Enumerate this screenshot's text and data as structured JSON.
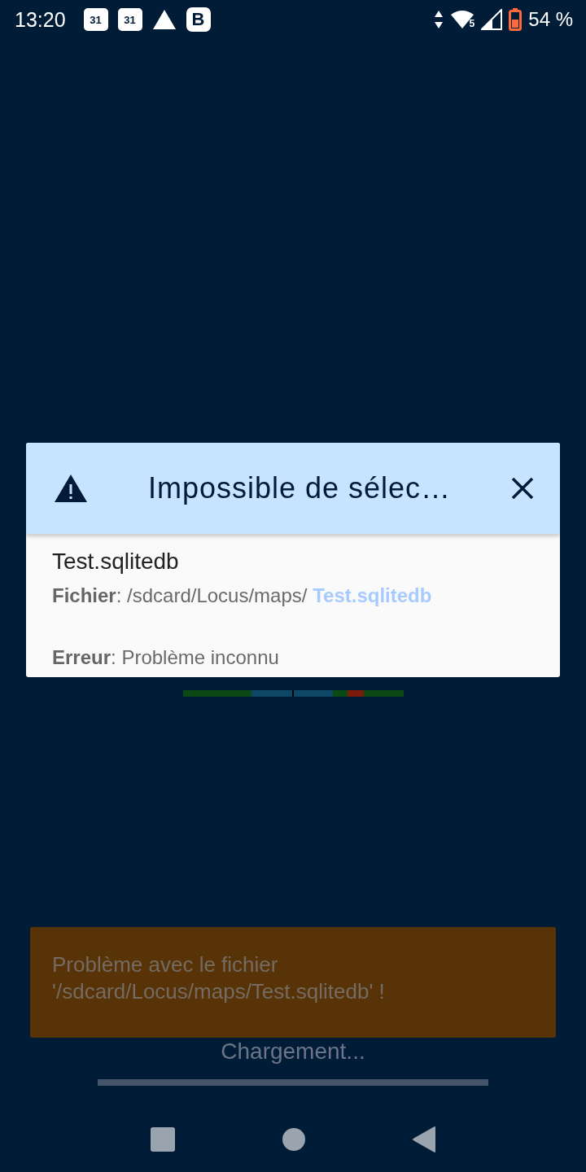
{
  "status_bar": {
    "time": "13:20",
    "notification_icons": [
      {
        "kind": "calendar",
        "text": "31"
      },
      {
        "kind": "calendar",
        "text": "31"
      },
      {
        "kind": "triangle"
      },
      {
        "kind": "badge",
        "text": "B"
      }
    ],
    "wifi_label": "5",
    "battery": "54 %"
  },
  "dialog": {
    "title": "Impossible de sélec…",
    "file_name": "Test.sqlitedb",
    "details": [
      {
        "text": "**Fichier**: /sdcard/Locus/maps/ ",
        "link": "Test.sqlitedb"
      },
      {
        "text": "**Erreur**: Problème inconnu"
      }
    ]
  },
  "loading_text": "Chargement...",
  "toast": {
    "message": "Problème avec le fichier '/sdcard/Locus/maps/Test.sqlitedb' !"
  }
}
